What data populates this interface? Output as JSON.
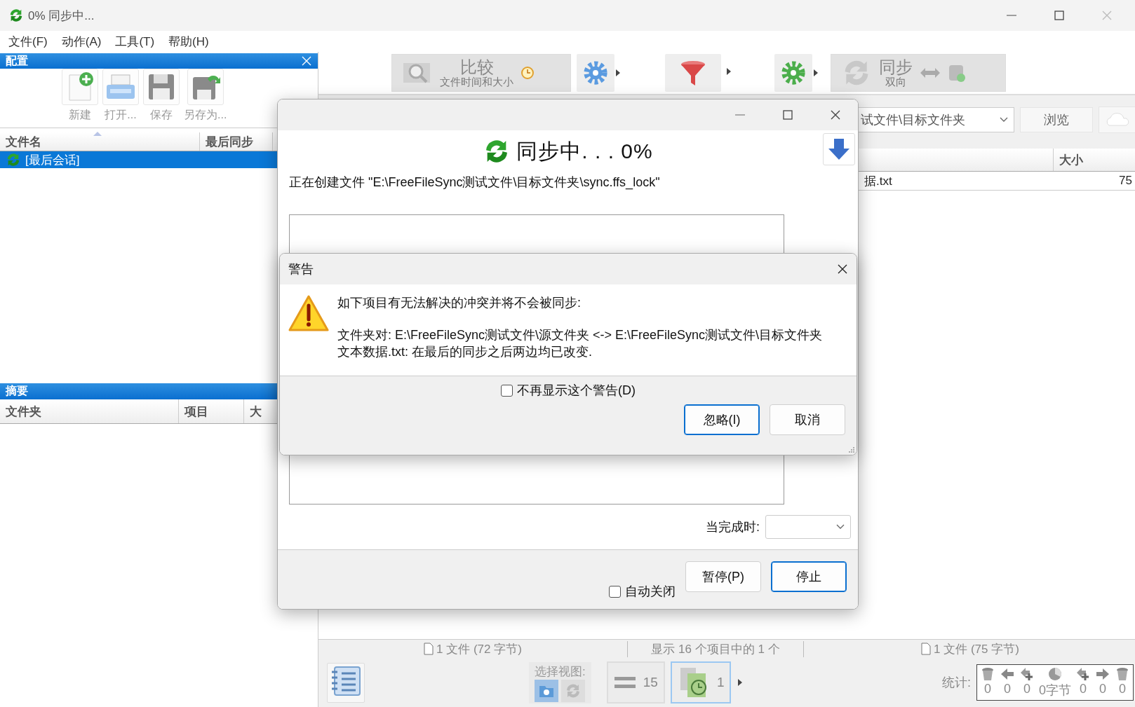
{
  "window": {
    "title": "0% 同步中..."
  },
  "menu": [
    "文件(F)",
    "动作(A)",
    "工具(T)",
    "帮助(H)"
  ],
  "config_panel": {
    "title": "配置",
    "buttons": [
      "新建",
      "打开...",
      "保存",
      "另存为..."
    ],
    "columns": [
      "文件名",
      "最后同步"
    ],
    "rows": [
      {
        "name": "[最后会话]",
        "selected": true
      }
    ]
  },
  "summary_panel": {
    "title": "摘要",
    "columns": [
      "文件夹",
      "项目",
      "大"
    ]
  },
  "toolbar": {
    "compare": {
      "label": "比较",
      "sub": "文件时间和大小"
    },
    "sync": {
      "label": "同步",
      "sub": "双向"
    }
  },
  "right_pane": {
    "folder": "试文件\\目标文件夹",
    "browse": "浏览",
    "columns": [
      "大小"
    ],
    "rows": [
      {
        "name": "据.txt",
        "size": "75"
      }
    ]
  },
  "status_bar": {
    "left": "1 文件 (72 字节)",
    "center": "显示 16 个项目中的 1 个",
    "right": "1 文件 (75 字节)"
  },
  "bottom_bar": {
    "view_label": "选择视图:",
    "view_modes": [
      {
        "selected": true
      },
      {
        "selected": false
      }
    ],
    "view_buttons": [
      {
        "count": "15",
        "selected": false
      },
      {
        "count": "1",
        "selected": true
      }
    ],
    "stats_label": "统计:",
    "stats": [
      "0",
      "0",
      "0",
      "0字节",
      "0",
      "0",
      "0"
    ]
  },
  "progress_dialog": {
    "title": "同步中. . . 0%",
    "status": "正在创建文件 \"E:\\FreeFileSync测试文件\\目标文件夹\\sync.ffs_lock\"",
    "on_completion_label": "当完成时:",
    "auto_close": {
      "label": "自动关闭",
      "checked": false
    },
    "buttons": [
      {
        "label": "暂停(P)",
        "default": false
      },
      {
        "label": "停止",
        "default": true
      }
    ]
  },
  "warning_dialog": {
    "title": "警告",
    "message": "如下项目有无法解决的冲突并将不会被同步:",
    "details": [
      "文件夹对: E:\\FreeFileSync测试文件\\源文件夹 <-> E:\\FreeFileSync测试文件\\目标文件夹",
      "文本数据.txt: 在最后的同步之后两边均已改变."
    ],
    "dont_show": {
      "label": "不再显示这个警告(D)",
      "checked": false
    },
    "buttons": [
      {
        "label": "忽略(I)",
        "default": true
      },
      {
        "label": "取消",
        "default": false
      }
    ]
  }
}
